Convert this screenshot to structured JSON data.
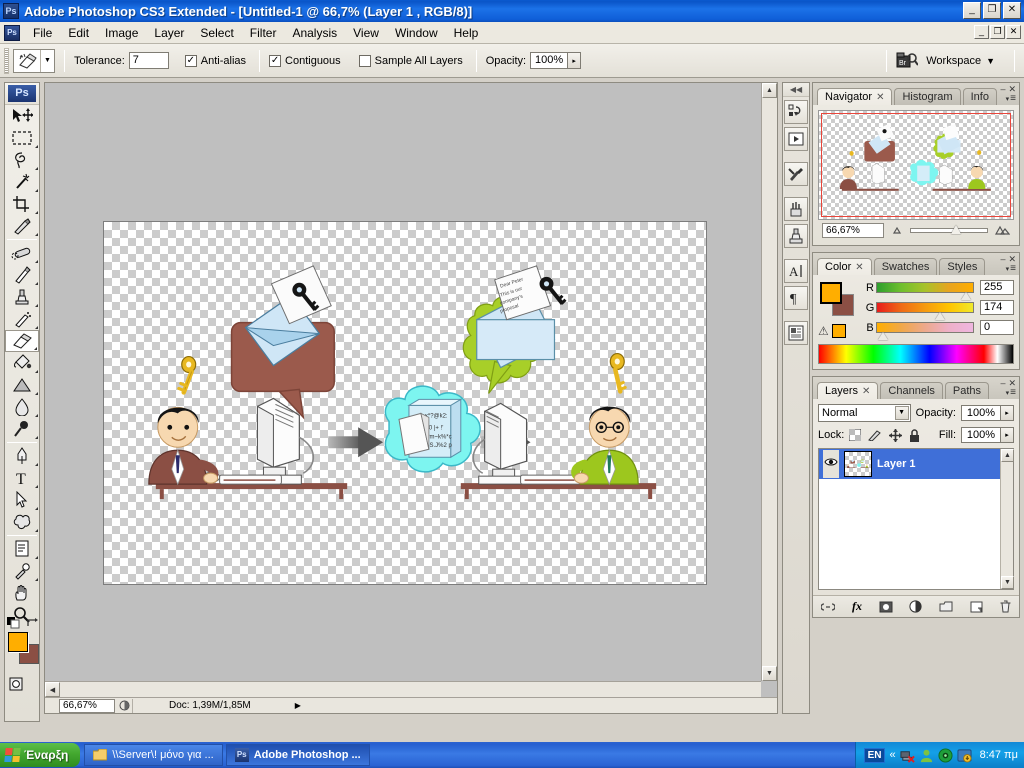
{
  "titlebar": {
    "app_badge": "Ps",
    "title": "Adobe Photoshop CS3 Extended - [Untitled-1 @ 66,7% (Layer 1 , RGB/8)]",
    "minimize": "_",
    "restore": "❐",
    "close": "✕"
  },
  "menubar": {
    "doc_badge": "Ps",
    "items": [
      {
        "label": "File"
      },
      {
        "label": "Edit"
      },
      {
        "label": "Image"
      },
      {
        "label": "Layer"
      },
      {
        "label": "Select"
      },
      {
        "label": "Filter"
      },
      {
        "label": "Analysis"
      },
      {
        "label": "View"
      },
      {
        "label": "Window"
      },
      {
        "label": "Help"
      }
    ],
    "doc_minimize": "_",
    "doc_restore": "❐",
    "doc_close": "✕"
  },
  "options": {
    "tool_icon": "magic-eraser-icon",
    "preset_arrow": "▼",
    "tolerance_label": "Tolerance:",
    "tolerance_value": "7",
    "antialias_label": "Anti-alias",
    "antialias_checked": "✓",
    "contiguous_label": "Contiguous",
    "contiguous_checked": "✓",
    "sample_all_label": "Sample All Layers",
    "sample_all_checked": "",
    "opacity_label": "Opacity:",
    "opacity_value": "100%",
    "opacity_arrow": "▸",
    "bridge_badge": "Br",
    "workspace_label": "Workspace",
    "workspace_arrow": "▼"
  },
  "toolbox": {
    "brand": "Ps",
    "tools": [
      {
        "name": "move-tool",
        "selected": false
      },
      {
        "name": "rectangular-marquee-tool",
        "selected": false
      },
      {
        "name": "lasso-tool",
        "selected": false
      },
      {
        "name": "magic-wand-tool",
        "selected": false
      },
      {
        "name": "crop-tool",
        "selected": false
      },
      {
        "name": "slice-tool",
        "selected": false
      },
      {
        "name": "healing-brush-tool",
        "selected": false
      },
      {
        "name": "brush-tool",
        "selected": false
      },
      {
        "name": "clone-stamp-tool",
        "selected": false
      },
      {
        "name": "history-brush-tool",
        "selected": false
      },
      {
        "name": "eraser-tool",
        "selected": true
      },
      {
        "name": "paint-bucket-tool",
        "selected": false
      },
      {
        "name": "gradient-tool",
        "selected": false
      },
      {
        "name": "blur-tool",
        "selected": false
      },
      {
        "name": "dodge-tool",
        "selected": false
      },
      {
        "name": "pen-tool",
        "selected": false
      },
      {
        "name": "type-tool",
        "selected": false
      },
      {
        "name": "path-selection-tool",
        "selected": false
      },
      {
        "name": "shape-tool",
        "selected": false
      },
      {
        "name": "notes-tool",
        "selected": false
      },
      {
        "name": "eyedropper-tool",
        "selected": false
      },
      {
        "name": "hand-tool",
        "selected": false
      },
      {
        "name": "zoom-tool",
        "selected": false
      }
    ],
    "foreground_color": "#ffae00",
    "background_color": "#8b4f44",
    "quick_mask_label": "quick-mask-mode",
    "screen_mode_label": "screen-mode"
  },
  "document": {
    "zoom_status": "66,67%",
    "doc_size": "Doc: 1,39M/1,85M",
    "status_arrow": "▶",
    "canvas_background": "transparent-checkerboard",
    "artwork": {
      "description": "Email encryption clipart: sender encrypts a message, it travels scrambled through the internet cloud, receiver decrypts it",
      "left_person_suit_color": "#8b4f44",
      "right_person_suit_color": "#9dc71e",
      "cloud_color": "#7df5f0",
      "key_color": "#e8b820",
      "envelope_color": "#bcdcf2",
      "letter_text_lines": [
        "Dear Peter",
        "This is our",
        "company's",
        "proposal"
      ],
      "encrypted_text_lines": [
        "x*?@k2:",
        "[J$0 |+ !'",
        "E£?m~k%*c",
        "%X/.S.J%2 p"
      ]
    }
  },
  "dock": {
    "buttons": [
      {
        "name": "actions-panel-icon"
      },
      {
        "name": "animation-panel-icon"
      },
      {
        "name": "tool-presets-panel-icon"
      },
      {
        "name": "brushes-panel-icon"
      },
      {
        "name": "clone-source-panel-icon"
      },
      {
        "name": "character-panel-icon"
      },
      {
        "name": "paragraph-panel-icon"
      },
      {
        "name": "layer-comps-panel-icon"
      }
    ]
  },
  "navigator_panel": {
    "tabs": [
      {
        "label": "Navigator",
        "active": true,
        "close": "✕"
      },
      {
        "label": "Histogram",
        "active": false
      },
      {
        "label": "Info",
        "active": false
      }
    ],
    "minimize": "–",
    "close": "✕",
    "menu_icon": "≡",
    "zoom_value": "66,67%",
    "zoom_out_icon": "small-mountain-icon",
    "zoom_in_icon": "large-mountain-icon"
  },
  "color_panel": {
    "tabs": [
      {
        "label": "Color",
        "active": true,
        "close": "✕"
      },
      {
        "label": "Swatches",
        "active": false
      },
      {
        "label": "Styles",
        "active": false
      }
    ],
    "minimize": "–",
    "close": "✕",
    "menu_icon": "≡",
    "foreground_color": "#ffae00",
    "background_color": "#8b4f44",
    "gamut_warning_icon": "⚠",
    "gamut_swatch_color": "#ffae00",
    "channels": [
      {
        "name": "R",
        "value": "255"
      },
      {
        "name": "G",
        "value": "174"
      },
      {
        "name": "B",
        "value": "0"
      }
    ]
  },
  "layers_panel": {
    "tabs": [
      {
        "label": "Layers",
        "active": true,
        "close": "✕"
      },
      {
        "label": "Channels",
        "active": false
      },
      {
        "label": "Paths",
        "active": false
      }
    ],
    "minimize": "–",
    "close": "✕",
    "menu_icon": "≡",
    "blend_mode": "Normal",
    "blend_arrow": "▼",
    "opacity_label": "Opacity:",
    "opacity_value": "100%",
    "opacity_arrow": "▸",
    "lock_label": "Lock:",
    "lock_icons": [
      {
        "name": "lock-transparent-pixels-icon"
      },
      {
        "name": "lock-image-pixels-icon"
      },
      {
        "name": "lock-position-icon"
      },
      {
        "name": "lock-all-icon"
      }
    ],
    "fill_label": "Fill:",
    "fill_value": "100%",
    "fill_arrow": "▸",
    "layers": [
      {
        "name": "Layer 1",
        "visible": true,
        "selected": true,
        "eye": "◉"
      }
    ],
    "footer_buttons": [
      {
        "name": "link-layers-button",
        "glyph": "⚭"
      },
      {
        "name": "layer-style-button",
        "glyph": "fx"
      },
      {
        "name": "layer-mask-button",
        "glyph": "□"
      },
      {
        "name": "adjustment-layer-button",
        "glyph": "◐"
      },
      {
        "name": "new-group-button",
        "glyph": "▭"
      },
      {
        "name": "new-layer-button",
        "glyph": "❐"
      },
      {
        "name": "delete-layer-button",
        "glyph": "Ὕ1"
      }
    ]
  },
  "taskbar": {
    "start_label": "Έναρξη",
    "items": [
      {
        "label": "\\\\Server\\! μόνο για ...",
        "icon": "folder-icon",
        "active": false
      },
      {
        "label": "Adobe Photoshop ...",
        "icon": "photoshop-icon",
        "active": true
      }
    ],
    "tray": {
      "language": "EN",
      "expand_arrow": "«",
      "icons": [
        {
          "name": "network-disconnected-icon"
        },
        {
          "name": "user-icon"
        },
        {
          "name": "antivirus-icon"
        },
        {
          "name": "update-icon"
        }
      ],
      "time": "8:47 πμ"
    }
  }
}
